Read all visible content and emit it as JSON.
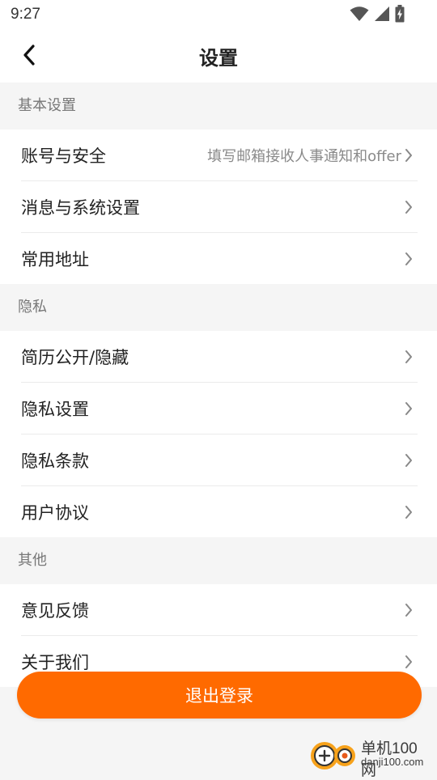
{
  "status_bar": {
    "time": "9:27",
    "icons": [
      "wifi-icon",
      "signal-icon",
      "battery-charging-icon"
    ]
  },
  "header": {
    "title": "设置",
    "back_icon": "chevron-left-icon"
  },
  "sections": [
    {
      "title": "基本设置",
      "items": [
        {
          "label": "账号与安全",
          "hint": "填写邮箱接收人事通知和offer"
        },
        {
          "label": "消息与系统设置",
          "hint": ""
        },
        {
          "label": "常用地址",
          "hint": ""
        }
      ]
    },
    {
      "title": "隐私",
      "items": [
        {
          "label": "简历公开/隐藏",
          "hint": ""
        },
        {
          "label": "隐私设置",
          "hint": ""
        },
        {
          "label": "隐私条款",
          "hint": ""
        },
        {
          "label": "用户协议",
          "hint": ""
        }
      ]
    },
    {
      "title": "其他",
      "items": [
        {
          "label": "意见反馈",
          "hint": ""
        },
        {
          "label": "关于我们",
          "hint": ""
        }
      ]
    }
  ],
  "logout_label": "退出登录",
  "watermark": {
    "main": "单机100网",
    "sub": "danji100.com"
  },
  "colors": {
    "accent": "#ff6a00",
    "background": "#f5f5f5",
    "surface": "#ffffff",
    "text_primary": "#222222",
    "text_secondary": "#777777"
  }
}
